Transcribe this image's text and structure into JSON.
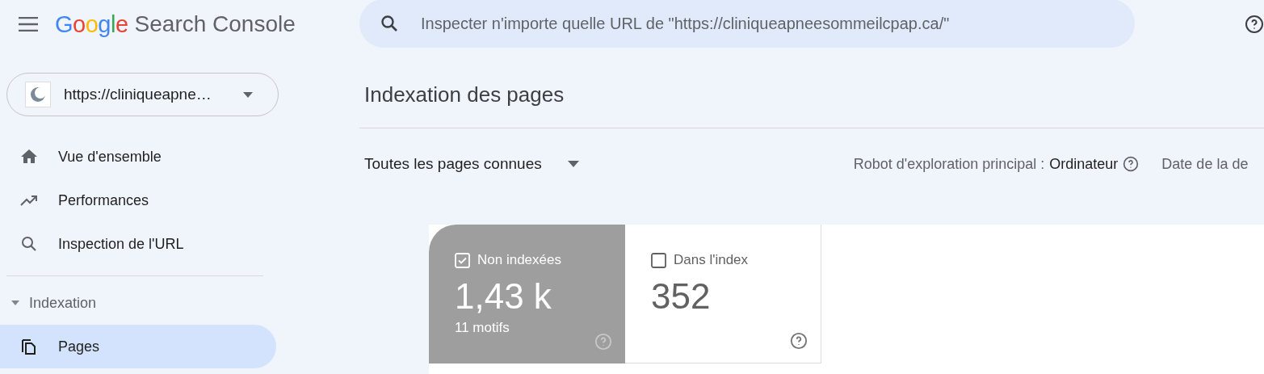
{
  "header": {
    "logo_word": "Google",
    "product": "Search Console",
    "search": {
      "placeholder": "Inspecter n'importe quelle URL de \"https://cliniqueapneesommeilcpap.ca/\""
    }
  },
  "property": {
    "label": "https://cliniqueapne…"
  },
  "sidebar": {
    "items": [
      {
        "label": "Vue d'ensemble",
        "kind": "home",
        "selected": false
      },
      {
        "label": "Performances",
        "kind": "trend",
        "selected": false
      },
      {
        "label": "Inspection de l'URL",
        "kind": "search",
        "selected": false
      }
    ],
    "section": {
      "label": "Indexation",
      "expanded": true,
      "items": [
        {
          "label": "Pages",
          "kind": "pages",
          "selected": true
        }
      ]
    }
  },
  "main": {
    "title": "Indexation des pages",
    "filter": "Toutes les pages connues",
    "crawler_label": "Robot d'exploration principal :",
    "crawler_value": "Ordinateur",
    "date_label": "Date de la de"
  },
  "cards": [
    {
      "label": "Non indexées",
      "value": "1,43 k",
      "sub": "11 motifs",
      "checked": true
    },
    {
      "label": "Dans l'index",
      "value": "352",
      "checked": false
    }
  ]
}
